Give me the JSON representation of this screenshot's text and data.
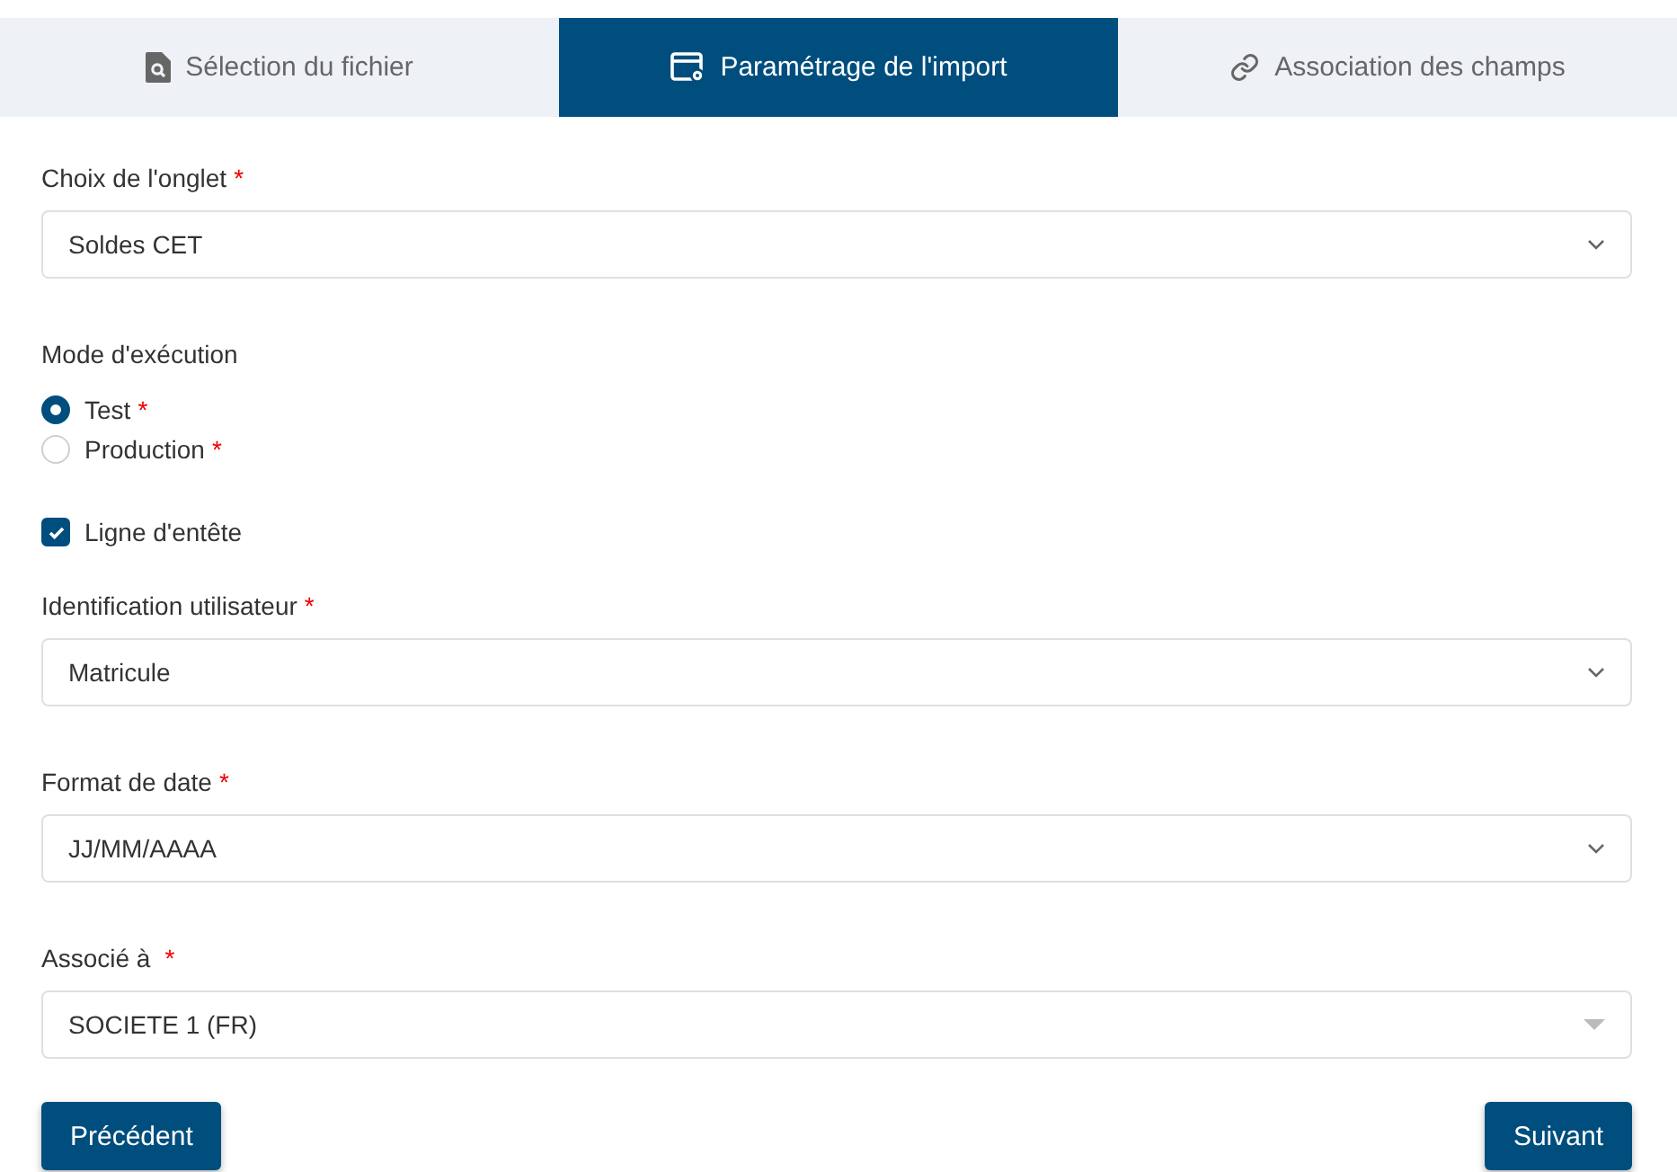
{
  "tabs": [
    {
      "label": "Sélection du fichier",
      "kind": "file",
      "selected": false
    },
    {
      "label": "Paramétrage de l'import",
      "kind": "settings",
      "selected": true
    },
    {
      "label": "Association des champs",
      "kind": "link",
      "selected": false
    }
  ],
  "sheet": {
    "label": "Choix de l'onglet",
    "required_mark": "*",
    "value": "Soldes CET",
    "kind": "chevron"
  },
  "mode": {
    "label": "Mode d'exécution",
    "options": [
      {
        "label": "Test",
        "required_mark": "*",
        "selected": true
      },
      {
        "label": "Production",
        "required_mark": "*",
        "selected": false
      }
    ]
  },
  "header_row": {
    "label": "Ligne d'entête",
    "checked": true
  },
  "fields": [
    {
      "label": "Identification utilisateur",
      "required_mark": "*",
      "value": "Matricule",
      "kind": "chevron"
    },
    {
      "label": "Format de date",
      "required_mark": "*",
      "value": "JJ/MM/AAAA",
      "kind": "chevron"
    },
    {
      "label": "Associé à",
      "required_mark": "*",
      "value": "SOCIETE 1 (FR)",
      "kind": "triangle"
    }
  ],
  "buttons": {
    "previous": "Précédent",
    "next": "Suivant"
  }
}
